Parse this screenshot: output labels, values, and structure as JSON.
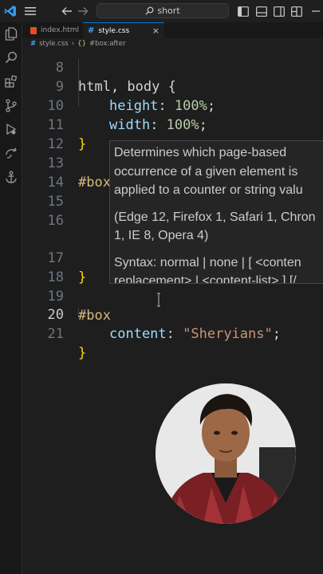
{
  "titlebar": {
    "search_text": "short",
    "icons": [
      "vscode-logo-icon",
      "menu-icon",
      "back-arrow-icon",
      "forward-arrow-icon",
      "search-icon",
      "toggle-primary-sidebar-icon",
      "toggle-panel-icon",
      "toggle-secondary-sidebar-icon",
      "customize-layout-icon"
    ]
  },
  "activity_bar": {
    "icons": [
      "explorer-icon",
      "search-icon",
      "extensions-icon",
      "source-control-icon",
      "run-debug-icon",
      "remote-icon",
      "anchor-icon"
    ]
  },
  "tabs": [
    {
      "label": "index.html",
      "active": false,
      "icon": "html-file-icon"
    },
    {
      "label": "style.css",
      "active": true,
      "icon": "css-file-icon",
      "close": "×"
    }
  ],
  "breadcrumbs": {
    "file": "style.css",
    "selector": "#box:after",
    "separator": "›"
  },
  "editor": {
    "current_line": "20",
    "lines": [
      {
        "n": "8",
        "code": "html, body {"
      },
      {
        "n": "9",
        "prop": "height",
        "value": "100%"
      },
      {
        "n": "10",
        "prop": "width",
        "value": "100%"
      },
      {
        "n": "11",
        "code": "}"
      },
      {
        "n": "12",
        "code": ""
      },
      {
        "n": "13",
        "code": "#box{"
      },
      {
        "n": "14",
        "code": ""
      },
      {
        "n": "15",
        "code": ""
      },
      {
        "n": "16",
        "code": ""
      },
      {
        "n": "17",
        "code": "}"
      },
      {
        "n": "18",
        "code": ""
      },
      {
        "n": "19",
        "code": "#box"
      },
      {
        "n": "20",
        "prop": "content",
        "value": "\"Sheryians\""
      },
      {
        "n": "21",
        "code": "}"
      }
    ]
  },
  "hover_tooltip": {
    "description": [
      "Determines which page-based",
      "occurrence of a given element is",
      "applied to a counter or string valu"
    ],
    "browsers": [
      "(Edge 12, Firefox 1, Safari 1, Chron",
      "1, IE 8, Opera 4)"
    ],
    "syntax": [
      "Syntax: normal | none | [ <conten",
      "replacement> | <content-list> ] [/"
    ]
  },
  "colors": {
    "editor_bg": "#1e1e1e",
    "accent": "#0078d4",
    "property": "#9cdcfe",
    "number": "#b5cea8",
    "string": "#ce9178",
    "selector": "#d7ba7d"
  }
}
